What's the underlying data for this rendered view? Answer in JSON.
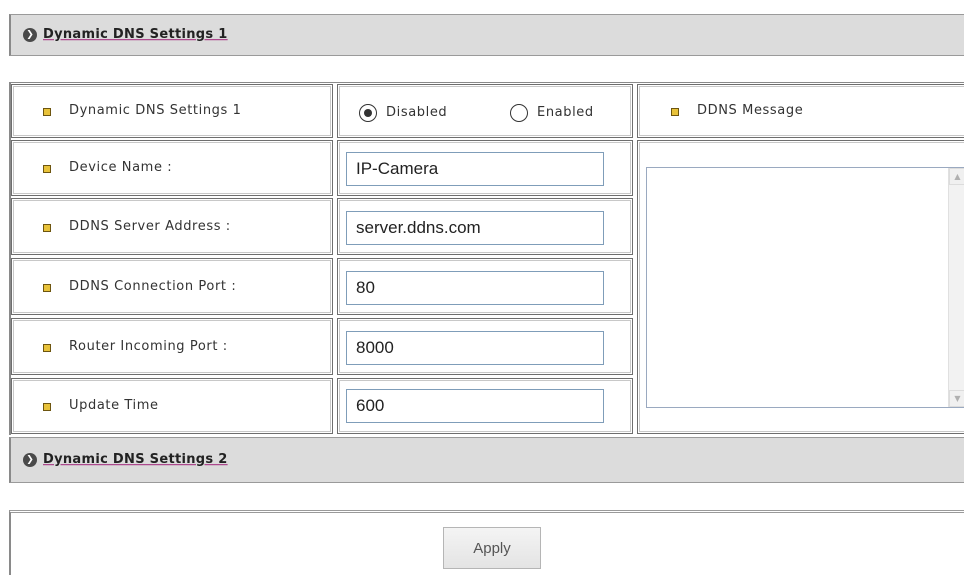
{
  "section1": {
    "title": "Dynamic DNS Settings 1"
  },
  "section2": {
    "title": "Dynamic DNS Settings 2"
  },
  "settings": {
    "mode_label": "Dynamic DNS Settings 1",
    "radio_disabled": "Disabled",
    "radio_enabled": "Enabled",
    "selected": "Disabled",
    "ddns_message_label": "DDNS Message",
    "device_name_label": "Device Name :",
    "device_name_value": "IP-Camera",
    "server_label": "DDNS Server Address :",
    "server_value": "server.ddns.com",
    "conn_port_label": "DDNS Connection Port :",
    "conn_port_value": "80",
    "router_port_label": "Router Incoming Port :",
    "router_port_value": "8000",
    "update_time_label": "Update Time",
    "update_time_value": "600",
    "ddns_message_value": ""
  },
  "apply_label": "Apply",
  "colors": {
    "header_bg": "#dcdcdc",
    "bullet": "#e8c23a",
    "link_underline": "#a0257a"
  },
  "icons": {
    "section_arrow": "right-arrow-icon",
    "bullet": "square-bullet-icon",
    "scroll_up": "scroll-up-icon",
    "scroll_down": "scroll-down-icon"
  }
}
